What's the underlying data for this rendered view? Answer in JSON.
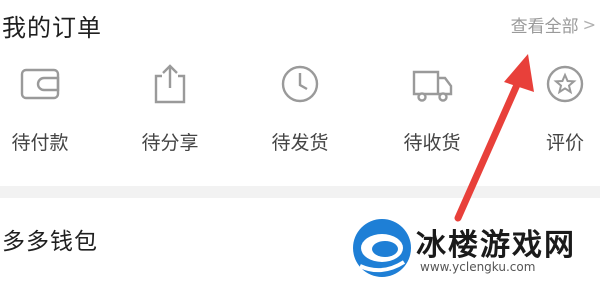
{
  "orders": {
    "title": "我的订单",
    "view_all": "查看全部",
    "statuses": [
      {
        "label": "待付款",
        "icon": "wallet-icon"
      },
      {
        "label": "待分享",
        "icon": "share-icon"
      },
      {
        "label": "待发货",
        "icon": "clock-icon"
      },
      {
        "label": "待收货",
        "icon": "truck-icon"
      },
      {
        "label": "评价",
        "icon": "review-star-icon"
      }
    ]
  },
  "wallet": {
    "title": "多多钱包"
  },
  "annotation": {
    "arrow_color": "#e8403a"
  },
  "watermark": {
    "text": "冰楼游戏网",
    "url": "www.yclengku.com",
    "logo_color": "#1e7fd6"
  }
}
